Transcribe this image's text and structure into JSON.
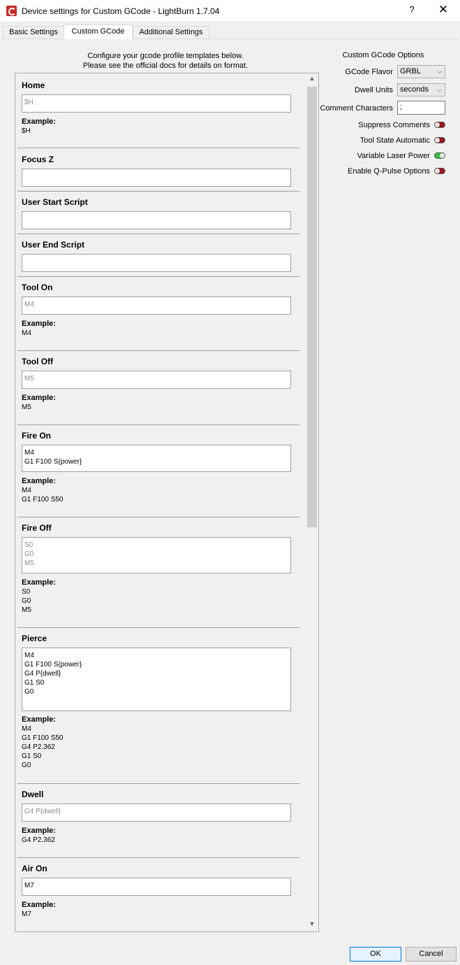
{
  "window": {
    "title": "Device settings for Custom GCode - LightBurn 1.7.04",
    "help": "?",
    "close": "✕"
  },
  "tabs": [
    {
      "label": "Basic Settings"
    },
    {
      "label": "Custom GCode"
    },
    {
      "label": "Additional Settings"
    }
  ],
  "intro": {
    "line1": "Configure your gcode profile templates below.",
    "line2": "Please see the official docs for details on format."
  },
  "sections": {
    "home": {
      "label": "Home",
      "placeholder": "$H",
      "example_label": "Example:",
      "example": "$H"
    },
    "focus_z": {
      "label": "Focus Z",
      "value": ""
    },
    "user_start": {
      "label": "User Start Script",
      "value": ""
    },
    "user_end": {
      "label": "User End Script",
      "value": ""
    },
    "tool_on": {
      "label": "Tool On",
      "placeholder": "M4",
      "example_label": "Example:",
      "example": "M4"
    },
    "tool_off": {
      "label": "Tool Off",
      "placeholder": "M5",
      "example_label": "Example:",
      "example": "M5"
    },
    "fire_on": {
      "label": "Fire On",
      "value": "M4\nG1 F100 S{power}",
      "example_label": "Example:",
      "example": "M4\nG1 F100 S50"
    },
    "fire_off": {
      "label": "Fire Off",
      "placeholder": "S0\nG0\nM5",
      "example_label": "Example:",
      "example": "S0\nG0\nM5"
    },
    "pierce": {
      "label": "Pierce",
      "value": "M4\nG1 F100 S{power}\nG4 P{dwell}\nG1 S0\nG0",
      "example_label": "Example:",
      "example": "M4\nG1 F100 S50\nG4 P2.362\nG1 S0\nG0"
    },
    "dwell": {
      "label": "Dwell",
      "placeholder": "G4 P{dwell}",
      "example_label": "Example:",
      "example": "G4 P2.362"
    },
    "air_on": {
      "label": "Air On",
      "value": "M7",
      "example_label": "Example:",
      "example": "M7"
    }
  },
  "options": {
    "title": "Custom GCode Options",
    "gcode_flavor": {
      "label": "GCode Flavor",
      "value": "GRBL"
    },
    "dwell_units": {
      "label": "Dwell Units",
      "value": "seconds"
    },
    "comment_chars": {
      "label": "Comment Characters",
      "value": ";"
    },
    "suppress_comments": {
      "label": "Suppress Comments",
      "on": false
    },
    "tool_state_auto": {
      "label": "Tool State Automatic",
      "on": false
    },
    "variable_laser_power": {
      "label": "Variable Laser Power",
      "on": true
    },
    "q_pulse": {
      "label": "Enable Q-Pulse Options",
      "on": false
    }
  },
  "colors": {
    "toggle_off": "#9c1818",
    "toggle_on": "#2fbf3a",
    "accent": "#0078d7"
  },
  "buttons": {
    "ok": "OK",
    "cancel": "Cancel"
  }
}
